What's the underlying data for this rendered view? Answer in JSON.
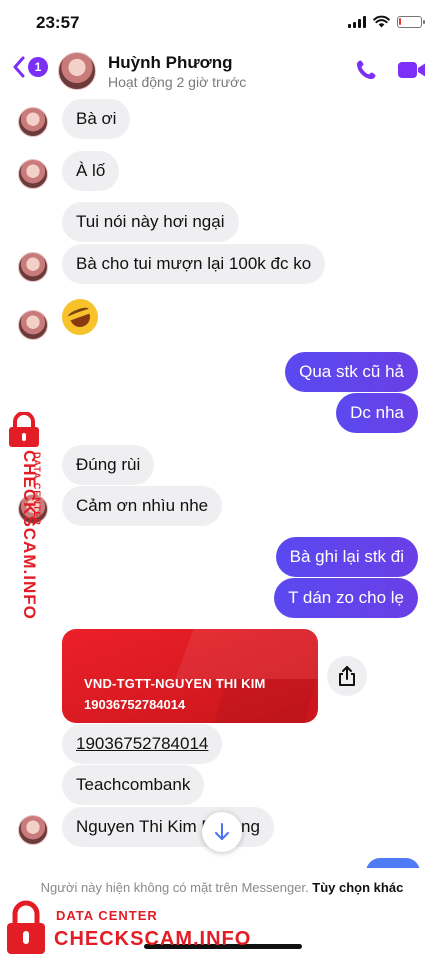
{
  "status_bar": {
    "time": "23:57",
    "battery_level": 0.12
  },
  "header": {
    "back_badge": "1",
    "contact_name": "Huỳnh Phương",
    "contact_status": "Hoạt động 2 giờ trước"
  },
  "messages": [
    {
      "sender": "contact",
      "text": "Bà ơi"
    },
    {
      "sender": "contact",
      "text": "À lố"
    },
    {
      "sender": "contact",
      "text": "Tui nói này hơi ngại"
    },
    {
      "sender": "contact",
      "text": "Bà cho tui mượn lại 100k đc ko"
    },
    {
      "sender": "contact",
      "type": "emoji",
      "emoji": "rolling-on-floor-laughing"
    },
    {
      "sender": "me",
      "text": "Qua stk cũ hả"
    },
    {
      "sender": "me",
      "text": "Dc nha"
    },
    {
      "sender": "contact",
      "text": "Đúng rùi"
    },
    {
      "sender": "contact",
      "text": "Cảm ơn nhìu nhe"
    },
    {
      "sender": "me",
      "text": "Bà ghi lại stk đi"
    },
    {
      "sender": "me",
      "text": "T dán zo cho lẹ"
    },
    {
      "sender": "contact",
      "type": "image",
      "line1": "VND-TGTT-NGUYEN THI KIM",
      "line2": "19036752784014"
    },
    {
      "sender": "contact",
      "text": "19036752784014"
    },
    {
      "sender": "contact",
      "text": "Teachcombank"
    },
    {
      "sender": "contact",
      "text": "Nguyen Thi Kim Phuong"
    }
  ],
  "footer": {
    "notice": "Người này hiện không có mặt trên Messenger.",
    "link": "Tùy chọn khác"
  },
  "watermark": {
    "small": "DATA CENTER",
    "big": "CHECKSCAM.INFO"
  },
  "colors": {
    "accent": "#7b2ff7",
    "outgoing": "#5a49f0",
    "incoming": "#efeff1",
    "card": "#e21d25",
    "watermark": "#e21d25"
  }
}
